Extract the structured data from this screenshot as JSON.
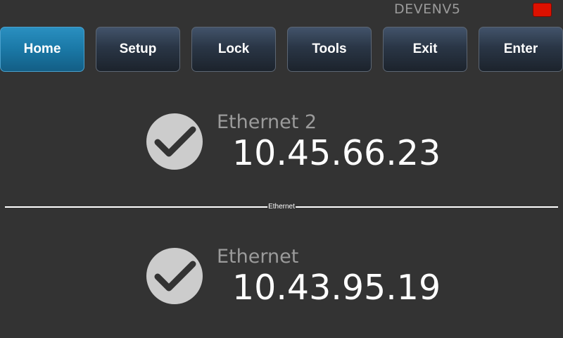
{
  "header": {
    "hostname": "DEVENV5",
    "status_color": "#dd1100"
  },
  "nav": {
    "buttons": [
      {
        "label": "Home",
        "active": true
      },
      {
        "label": "Setup",
        "active": false
      },
      {
        "label": "Lock",
        "active": false
      },
      {
        "label": "Tools",
        "active": false
      },
      {
        "label": "Exit",
        "active": false
      },
      {
        "label": "Enter",
        "active": false
      }
    ]
  },
  "connections": [
    {
      "name": "Ethernet 2",
      "ip": "10.45.66.23",
      "status_icon": "check-icon"
    },
    {
      "name": "Ethernet",
      "ip": "10.43.95.19",
      "status_icon": "check-icon"
    }
  ],
  "divider": {
    "label": "Ethernet"
  },
  "colors": {
    "background": "#333333",
    "active_button": "#1a78a6",
    "button": "#2a3646",
    "name_text": "#9b9b9b",
    "ip_text": "#ffffff",
    "check_circle": "#cccccc",
    "check_mark": "#333333"
  }
}
